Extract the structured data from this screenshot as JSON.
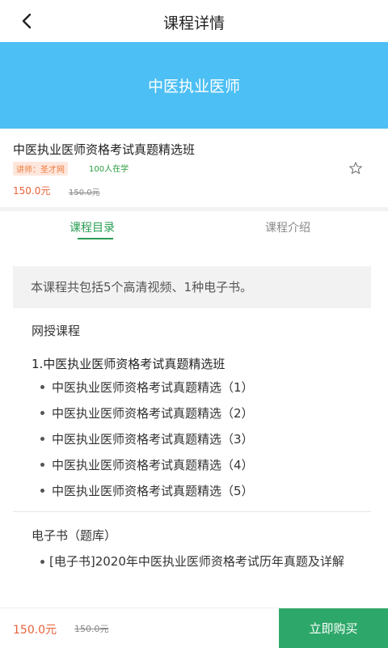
{
  "header": {
    "title": "课程详情"
  },
  "banner": {
    "text": "中医执业医师"
  },
  "course": {
    "name": "中医执业医师资格考试真题精选班",
    "teacher": "讲师：圣才网",
    "learners": "100人在学",
    "price": "150.0元",
    "old_price": "150.0元"
  },
  "tabs": [
    {
      "label": "课程目录",
      "active": true
    },
    {
      "label": "课程介绍",
      "active": false
    }
  ],
  "catalog": {
    "summary": "本课程共包括5个高清视频、1种电子书。",
    "online_title": "网授课程",
    "class_title": "1.中医执业医师资格考试真题精选班",
    "lessons": [
      "中医执业医师资格考试真题精选（1）",
      "中医执业医师资格考试真题精选（2）",
      "中医执业医师资格考试真题精选（3）",
      "中医执业医师资格考试真题精选（4）",
      "中医执业医师资格考试真题精选（5）"
    ],
    "ebook_title": "电子书（题库）",
    "ebooks": [
      "[电子书]2020年中医执业医师资格考试历年真题及详解"
    ]
  },
  "bottom": {
    "price": "150.0元",
    "old_price": "150.0元",
    "buy_label": "立即购买"
  },
  "colors": {
    "banner": "#4cbff4",
    "accent_green": "#2ea86a",
    "price_orange": "#e8623a"
  },
  "icons": {
    "back": "chevron-left-icon",
    "favorite": "star-outline-icon"
  }
}
